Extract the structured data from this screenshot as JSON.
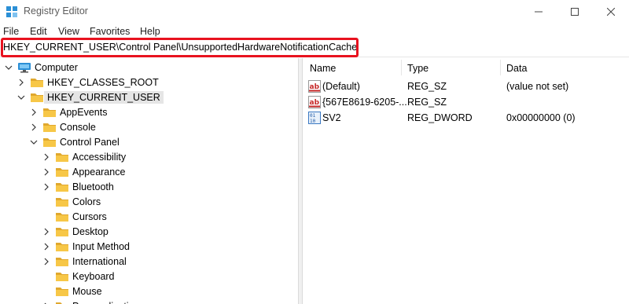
{
  "window": {
    "title": "Registry Editor"
  },
  "menu": [
    "File",
    "Edit",
    "View",
    "Favorites",
    "Help"
  ],
  "address": "HKEY_CURRENT_USER\\Control Panel\\UnsupportedHardwareNotificationCache",
  "tree": [
    {
      "label": "Computer",
      "level": 0,
      "state": "expanded",
      "icon": "computer-icon"
    },
    {
      "label": "HKEY_CLASSES_ROOT",
      "level": 1,
      "state": "collapsed",
      "icon": "folder-icon"
    },
    {
      "label": "HKEY_CURRENT_USER",
      "level": 1,
      "state": "expanded",
      "icon": "folder-icon",
      "selected": true
    },
    {
      "label": "AppEvents",
      "level": 2,
      "state": "collapsed",
      "icon": "folder-icon"
    },
    {
      "label": "Console",
      "level": 2,
      "state": "collapsed",
      "icon": "folder-icon"
    },
    {
      "label": "Control Panel",
      "level": 2,
      "state": "expanded",
      "icon": "folder-icon"
    },
    {
      "label": "Accessibility",
      "level": 3,
      "state": "collapsed",
      "icon": "folder-icon"
    },
    {
      "label": "Appearance",
      "level": 3,
      "state": "collapsed",
      "icon": "folder-icon"
    },
    {
      "label": "Bluetooth",
      "level": 3,
      "state": "collapsed",
      "icon": "folder-icon"
    },
    {
      "label": "Colors",
      "level": 3,
      "state": "none",
      "icon": "folder-icon"
    },
    {
      "label": "Cursors",
      "level": 3,
      "state": "none",
      "icon": "folder-icon"
    },
    {
      "label": "Desktop",
      "level": 3,
      "state": "collapsed",
      "icon": "folder-icon"
    },
    {
      "label": "Input Method",
      "level": 3,
      "state": "collapsed",
      "icon": "folder-icon"
    },
    {
      "label": "International",
      "level": 3,
      "state": "collapsed",
      "icon": "folder-icon"
    },
    {
      "label": "Keyboard",
      "level": 3,
      "state": "none",
      "icon": "folder-icon"
    },
    {
      "label": "Mouse",
      "level": 3,
      "state": "none",
      "icon": "folder-icon"
    },
    {
      "label": "Personalization",
      "level": 3,
      "state": "collapsed",
      "icon": "folder-icon"
    }
  ],
  "columns": {
    "name": "Name",
    "type": "Type",
    "data": "Data"
  },
  "values": [
    {
      "name": "(Default)",
      "type": "REG_SZ",
      "data": "(value not set)",
      "icon": "string-value-icon"
    },
    {
      "name": "{567E8619-6205-...",
      "type": "REG_SZ",
      "data": "",
      "icon": "string-value-icon"
    },
    {
      "name": "SV2",
      "type": "REG_DWORD",
      "data": "0x00000000 (0)",
      "icon": "binary-value-icon"
    }
  ],
  "colors": {
    "highlight": "#e8121f",
    "folder": "#f7c747",
    "computer": "#2b8fd6"
  }
}
